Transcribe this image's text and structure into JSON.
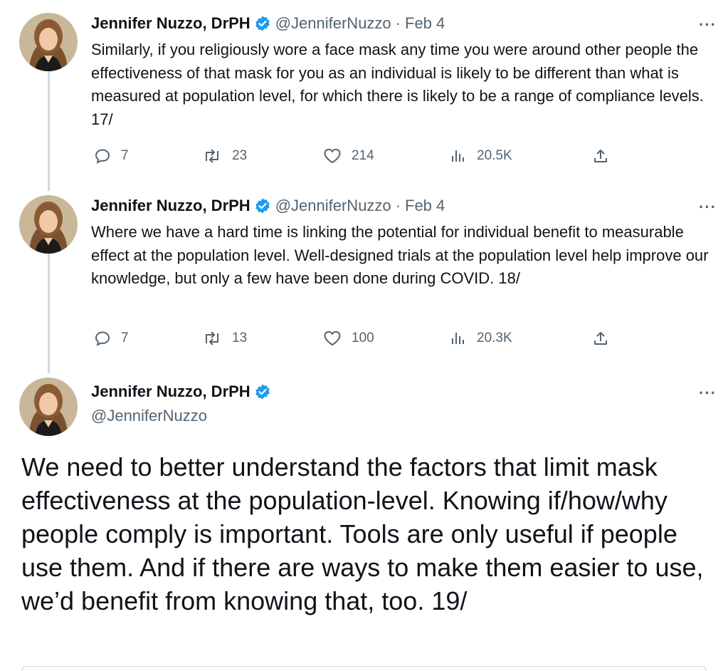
{
  "tweets": [
    {
      "author_name": "Jennifer Nuzzo, DrPH",
      "handle": "@JenniferNuzzo",
      "date": "Feb 4",
      "text": "Similarly, if you religiously wore a face mask any time you were around other people the effectiveness of that mask for you as an individual is likely to be different than what is measured at population level, for which there is likely to be a range of compliance levels. 17/",
      "replies": "7",
      "retweets": "23",
      "likes": "214",
      "views": "20.5K"
    },
    {
      "author_name": "Jennifer Nuzzo, DrPH",
      "handle": "@JenniferNuzzo",
      "date": "Feb 4",
      "text": "Where we have a hard time is linking the potential for individual benefit to measurable effect at the population level.  Well-designed trials at the population level help improve our knowledge, but only a few have been done during COVID. 18/",
      "replies": "7",
      "retweets": "13",
      "likes": "100",
      "views": "20.3K"
    }
  ],
  "main_tweet": {
    "author_name": "Jennifer Nuzzo, DrPH",
    "handle": "@JenniferNuzzo",
    "text": "We need to better understand the factors that limit mask effectiveness at the population-level. Knowing if/how/why people comply is important. Tools are only useful if people use them. And if there are ways to make them easier to use, we’d benefit from knowing that, too. 19/"
  },
  "ui": {
    "more_label": "···",
    "separator": "·"
  },
  "colors": {
    "verified_badge": "#1d9bf0",
    "secondary_text": "#536471",
    "thread_line": "#cfd9de"
  },
  "icons": [
    "reply-icon",
    "retweet-icon",
    "like-icon",
    "views-icon",
    "share-icon",
    "verified-badge-icon",
    "more-icon"
  ]
}
